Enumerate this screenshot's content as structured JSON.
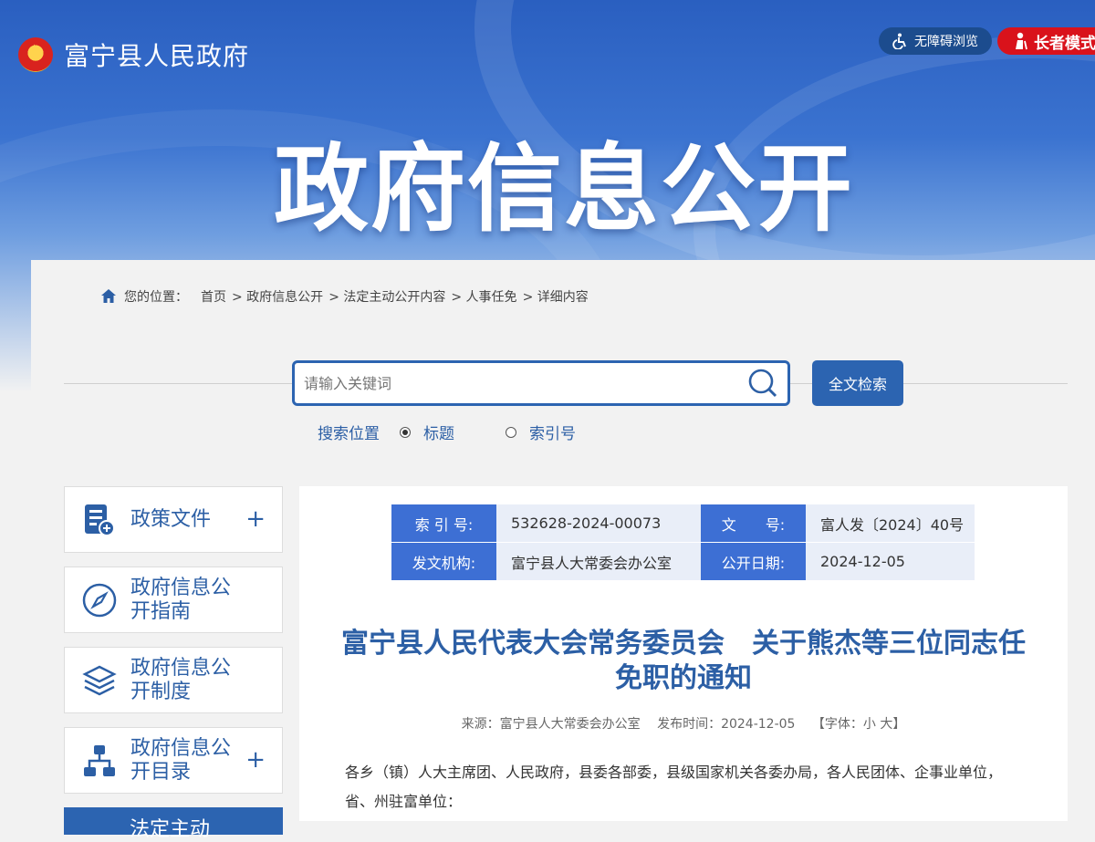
{
  "header": {
    "site_name": "富宁县人民政府",
    "accessibility_label": "无障碍浏览",
    "elder_mode_label": "长者模式",
    "banner_title": "政府信息公开"
  },
  "breadcrumb": {
    "prefix": "您的位置：",
    "items": [
      "首页",
      "> 政府信息公开",
      "> 法定主动公开内容",
      "> 人事任免",
      "> 详细内容"
    ]
  },
  "search": {
    "placeholder": "请输入关键词",
    "button_label": "全文检索",
    "scope_label": "搜索位置",
    "options": [
      "标题",
      "索引号"
    ],
    "selected": "标题"
  },
  "sidebar": {
    "items": [
      {
        "label": "政策文件",
        "expandable": "+"
      },
      {
        "label": "政府信息公开指南"
      },
      {
        "label": "政府信息公开制度"
      },
      {
        "label": "政府信息公开目录",
        "expandable": "+"
      }
    ],
    "active_label": "法定主动"
  },
  "meta": {
    "index_key": "索 引 号:",
    "index_value": "532628-2024-00073",
    "doc_no_key": "文　　号:",
    "doc_no_value": "富人发〔2024〕40号",
    "issuer_key": "发文机构:",
    "issuer_value": "富宁县人大常委会办公室",
    "date_key": "公开日期:",
    "date_value": "2024-12-05"
  },
  "article": {
    "title": "富宁县人民代表大会常务委员会　关于熊杰等三位同志任免职的通知",
    "source": "来源：富宁县人大常委会办公室",
    "publish_time": "发布时间：2024-12-05",
    "font_size_label": "【字体：小 大】",
    "body": "各乡（镇）人大主席团、人民政府，县委各部委，县级国家机关各委办局，各人民团体、企事业单位，省、州驻富单位："
  },
  "colors": {
    "primary": "#2c64b1",
    "meta_key_bg": "#3d6fd4",
    "elder_red": "#d9121b"
  }
}
